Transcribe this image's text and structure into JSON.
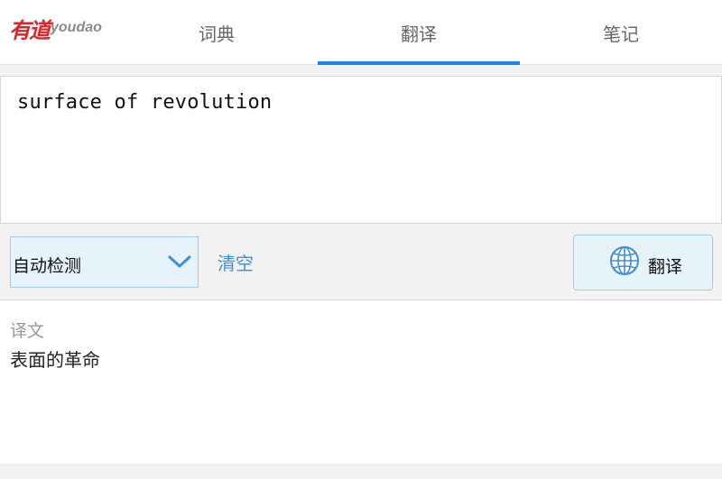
{
  "logo": {
    "text_cn": "有道",
    "text_en": "youdao"
  },
  "tabs": [
    {
      "label": "词典",
      "active": false
    },
    {
      "label": "翻译",
      "active": true
    },
    {
      "label": "笔记",
      "active": false
    }
  ],
  "input": {
    "value": "surface of revolution"
  },
  "language_select": {
    "selected": "自动检测"
  },
  "clear_label": "清空",
  "translate_button": {
    "label": "翻译"
  },
  "result": {
    "label": "译文",
    "text": "表面的革命"
  },
  "colors": {
    "accent": "#1a86e0",
    "link": "#3f8ed6",
    "logo_red": "#d9262b",
    "button_bg": "#e7f3fb"
  },
  "icons": {
    "language_dropdown": "chevron-down-icon",
    "translate": "globe-icon"
  }
}
